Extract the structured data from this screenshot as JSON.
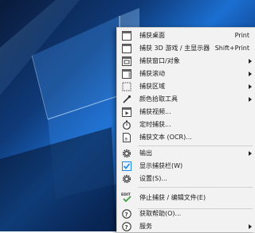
{
  "context_menu": {
    "items": [
      {
        "label": "捕获桌面",
        "shortcut": "Print",
        "icon": "monitor-icon"
      },
      {
        "label": "捕获 3D 游戏 / 主显示器",
        "shortcut": "Shift+Print",
        "icon": "monitor-icon"
      },
      {
        "label": "捕获窗口/对象",
        "submenu": true,
        "icon": "window-icon"
      },
      {
        "label": "捕获滚动",
        "submenu": true,
        "icon": "scroll-window-icon"
      },
      {
        "label": "捕获区域",
        "submenu": true,
        "icon": "region-select-icon"
      },
      {
        "label": "颜色拾取工具",
        "submenu": true,
        "icon": "eyedropper-icon"
      },
      {
        "label": "捕获视频...",
        "icon": "video-window-icon"
      },
      {
        "label": "定时捕获...",
        "icon": "stopwatch-icon"
      },
      {
        "label": "捕获文本 (OCR)...",
        "icon": "ocr-document-icon"
      },
      {
        "label": "输出",
        "submenu": true,
        "icon": "gear-icon"
      },
      {
        "label": "显示捕获栏(W)",
        "icon": "checkbox-checked-icon",
        "checked": true
      },
      {
        "label": "设置(S)...",
        "icon": "gear-icon"
      },
      {
        "label": "停止捕获 / 编辑文件(E)",
        "icon": "edit-check-icon",
        "icon_text": "EDIT"
      },
      {
        "label": "获取帮助(O)...",
        "icon": "help-icon"
      },
      {
        "label": "服务",
        "submenu": true,
        "icon": "help-icon"
      }
    ]
  },
  "colors": {
    "menu_bg": "#f2f2f2",
    "check": "#1e88e5",
    "desktop_blue": "#1b6fd1"
  }
}
